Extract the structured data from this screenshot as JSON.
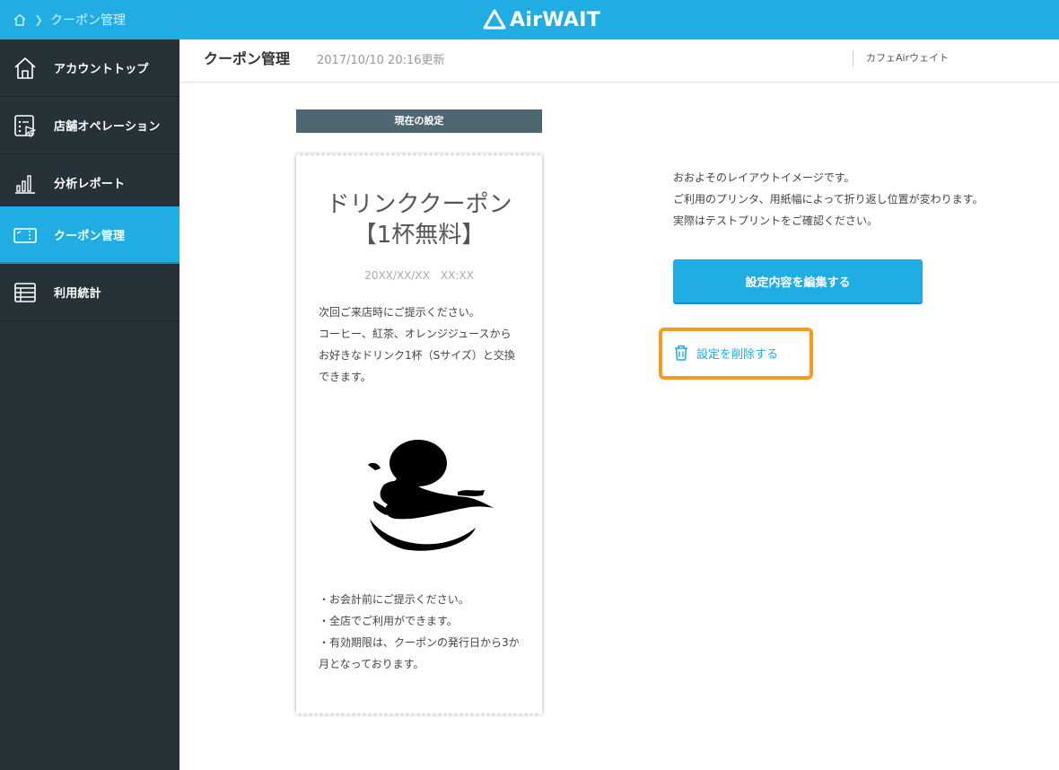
{
  "topbar": {
    "breadcrumb": "クーポン管理",
    "brand": "AirWAIT",
    "colors": {
      "bar": "#20ade3",
      "sidebar": "#263238",
      "accent": "#20ade3",
      "highlight": "#f89b1c"
    }
  },
  "sidebar": {
    "items": [
      {
        "label": "アカウントトップ",
        "icon": "home-icon"
      },
      {
        "label": "店舗オペレーション",
        "icon": "clipboard-cursor-icon"
      },
      {
        "label": "分析レポート",
        "icon": "bar-chart-icon"
      },
      {
        "label": "クーポン管理",
        "icon": "ticket-icon",
        "active": true
      },
      {
        "label": "利用統計",
        "icon": "table-icon"
      }
    ]
  },
  "header": {
    "title": "クーポン管理",
    "updated": "2017/10/10 20:16更新",
    "store": "カフェAirウェイト"
  },
  "receipt": {
    "section_label": "現在の設定",
    "title_line1": "ドリンククーポン",
    "title_line2": "【1杯無料】",
    "date": "20XX/XX/XX　XX:XX",
    "body": [
      "次回ご来店時にご提示ください。",
      "コーヒー、紅茶、オレンジジュースから",
      "お好きなドリンク1杯（Sサイズ）と交換",
      "できます。"
    ],
    "image": "coffee-cup-image",
    "notes": [
      "・お会計前にご提示ください。",
      "・全店でご利用ができます。",
      "・有効期限は、クーポンの発行日から3か",
      "月となっております。"
    ]
  },
  "info": {
    "lines": [
      "おおよそのレイアウトイメージです。",
      "ご利用のプリンタ、用紙幅によって折り返し位置が変わります。",
      "実際はテストプリントをご確認ください。"
    ]
  },
  "actions": {
    "edit_label": "設定内容を編集する",
    "delete_label": "設定を削除する",
    "delete_icon": "trash-icon"
  }
}
